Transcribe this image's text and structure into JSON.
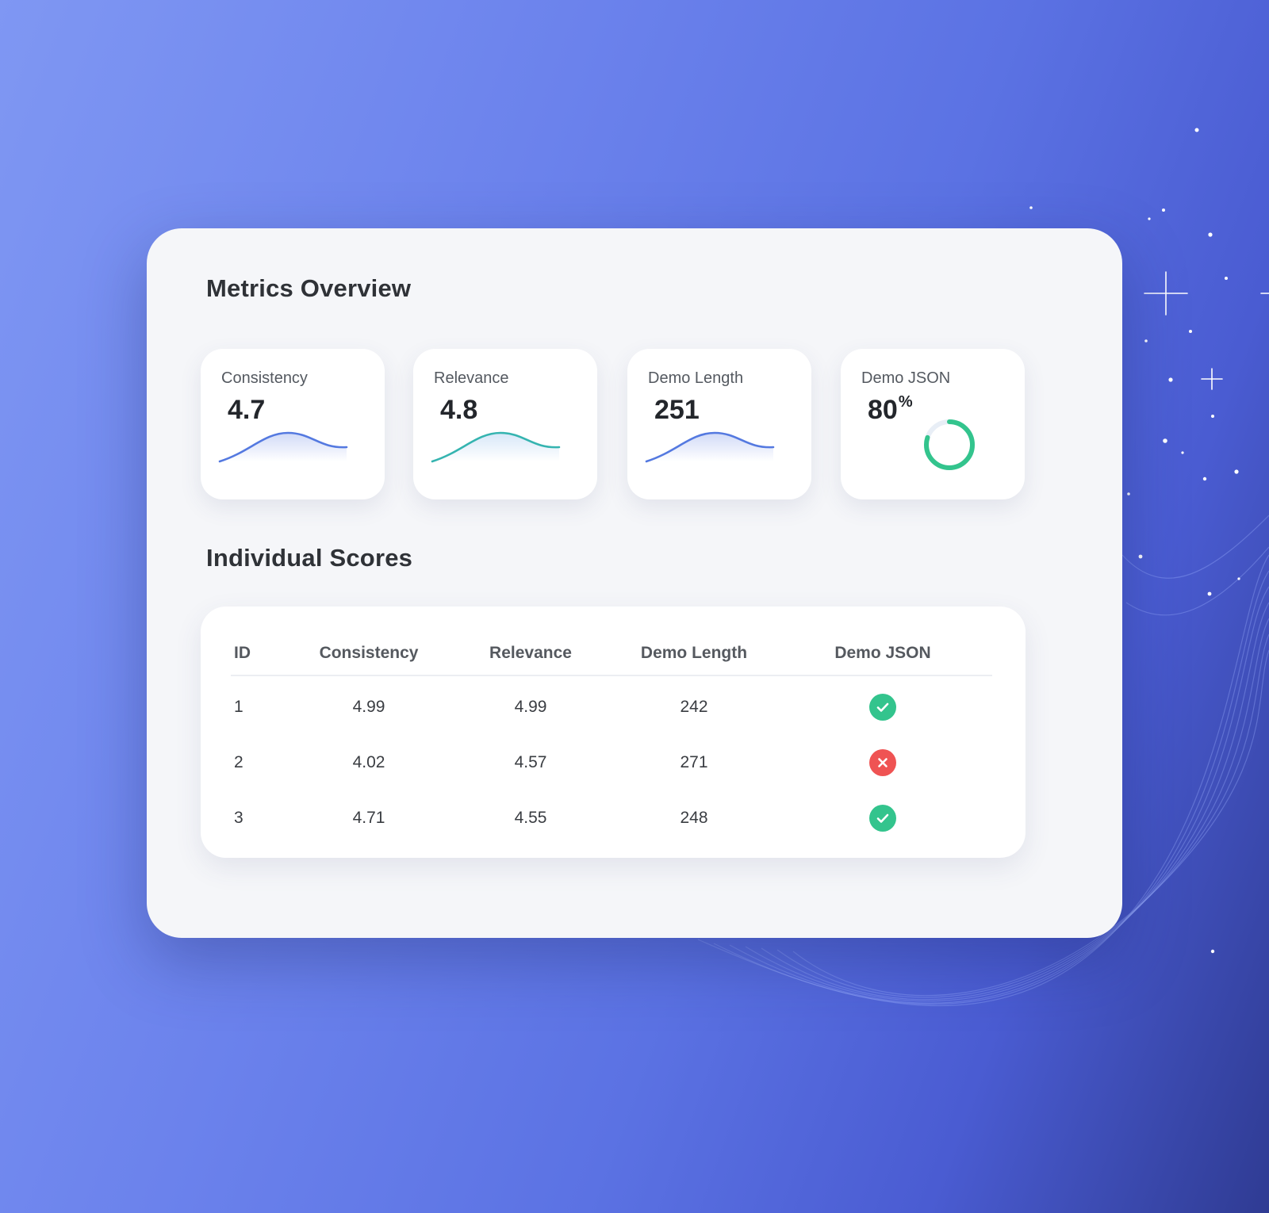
{
  "overview": {
    "title": "Metrics Overview",
    "metrics": [
      {
        "label": "Consistency",
        "value": "4.7",
        "trend_color": "#5479e0"
      },
      {
        "label": "Relevance",
        "value": "4.8",
        "trend_color": "#35b4b0"
      },
      {
        "label": "Demo Length",
        "value": "251",
        "trend_color": "#5479e0"
      },
      {
        "label": "Demo JSON",
        "value": "80",
        "unit": "%",
        "progress": 0.8,
        "ring_color": "#33c48d"
      }
    ]
  },
  "scores": {
    "title": "Individual Scores",
    "columns": [
      "ID",
      "Consistency",
      "Relevance",
      "Demo Length",
      "Demo JSON"
    ],
    "rows": [
      {
        "id": "1",
        "consistency": "4.99",
        "relevance": "4.99",
        "demo_length": "242",
        "demo_json": "check-icon"
      },
      {
        "id": "2",
        "consistency": "4.02",
        "relevance": "4.57",
        "demo_length": "271",
        "demo_json": "x-icon"
      },
      {
        "id": "3",
        "consistency": "4.71",
        "relevance": "4.55",
        "demo_length": "248",
        "demo_json": "check-icon"
      }
    ]
  },
  "colors": {
    "success": "#33c48d",
    "error": "#ef5353",
    "card_bg": "#f5f6f9"
  }
}
